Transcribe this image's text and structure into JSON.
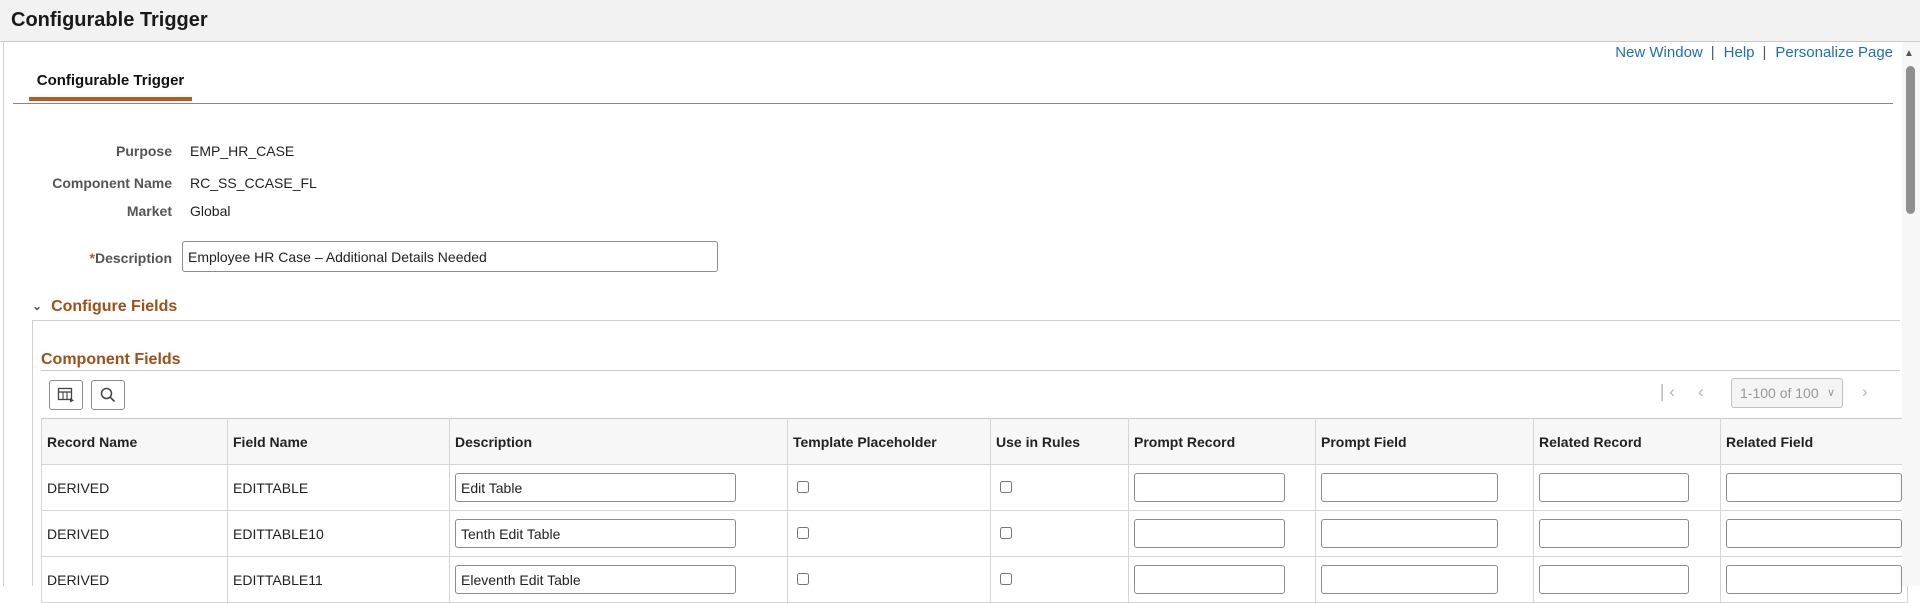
{
  "page": {
    "title": "Configurable Trigger"
  },
  "links": {
    "new_window": "New Window",
    "help": "Help",
    "personalize": "Personalize Page",
    "separator": "|"
  },
  "tab": {
    "label": "Configurable Trigger"
  },
  "form": {
    "purpose_label": "Purpose",
    "purpose_value": "EMP_HR_CASE",
    "component_label": "Component Name",
    "component_value": "RC_SS_CCASE_FL",
    "market_label": "Market",
    "market_value": "Global",
    "description_required": "*",
    "description_label": "Description",
    "description_value": "Employee HR Case – Additional Details Needed"
  },
  "section": {
    "title": "Configure Fields",
    "icon": "chevron-down-icon"
  },
  "grid": {
    "title": "Component Fields",
    "pager": {
      "range": "1-100 of 100"
    },
    "columns": [
      "Record Name",
      "Field Name",
      "Description",
      "Template Placeholder",
      "Use in Rules",
      "Prompt Record",
      "Prompt Field",
      "Related Record",
      "Related Field"
    ],
    "rows": [
      {
        "record": "DERIVED",
        "field": "EDITTABLE",
        "description": "Edit Table",
        "template_placeholder": false,
        "use_in_rules": false,
        "prompt_record": "",
        "prompt_field": "",
        "related_record": "",
        "related_field": ""
      },
      {
        "record": "DERIVED",
        "field": "EDITTABLE10",
        "description": "Tenth Edit Table",
        "template_placeholder": false,
        "use_in_rules": false,
        "prompt_record": "",
        "prompt_field": "",
        "related_record": "",
        "related_field": ""
      },
      {
        "record": "DERIVED",
        "field": "EDITTABLE11",
        "description": "Eleventh Edit Table",
        "template_placeholder": false,
        "use_in_rules": false,
        "prompt_record": "",
        "prompt_field": "",
        "related_record": "",
        "related_field": ""
      }
    ]
  },
  "colors": {
    "accent": "#a04f19",
    "tab_underline": "#b35c24",
    "link": "#1f6fb2"
  }
}
